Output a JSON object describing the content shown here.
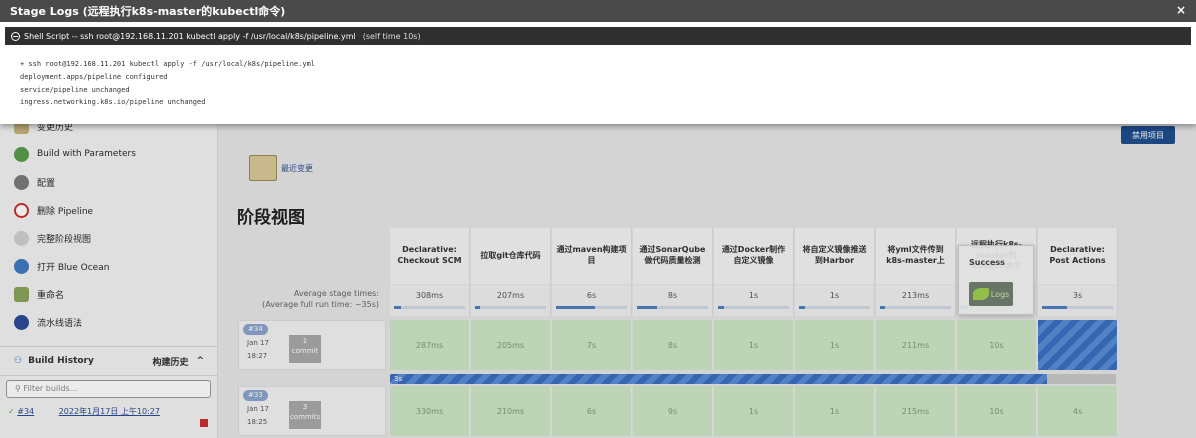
{
  "modal": {
    "title": "Stage Logs (远程执行k8s-master的kubectl命令)",
    "close_label": "×",
    "step": {
      "name": "Shell Script -- ssh root@192.168.11.201 kubectl apply -f /usr/local/k8s/pipeline.yml",
      "self_time": "(self time 10s)"
    },
    "log_lines": [
      "+ ssh root@192.168.11.201 kubectl apply -f /usr/local/k8s/pipeline.yml",
      "deployment.apps/pipeline configured",
      "service/pipeline unchanged",
      "ingress.networking.k8s.io/pipeline unchanged"
    ]
  },
  "sidebar": {
    "items": [
      {
        "label": "变更历史",
        "icon": "notepad-icon",
        "color": "#c6b27a"
      },
      {
        "label": "Build with Parameters",
        "icon": "build-icon",
        "color": "#5a9b4a"
      },
      {
        "label": "配置",
        "icon": "gear-icon",
        "color": "#7a7a7a"
      },
      {
        "label": "删除 Pipeline",
        "icon": "no-icon",
        "color": "#c93030"
      },
      {
        "label": "完整阶段视图",
        "icon": "search-icon",
        "color": "#8a8a8a"
      },
      {
        "label": "打开 Blue Ocean",
        "icon": "blue-ocean-icon",
        "color": "#3d7ac0"
      },
      {
        "label": "重命名",
        "icon": "rename-icon",
        "color": "#8ba35c"
      },
      {
        "label": "流水线语法",
        "icon": "help-icon",
        "color": "#2c4c95"
      }
    ],
    "build_history": {
      "label": "Build History",
      "label_cn": "构建历史",
      "toggle": "^"
    },
    "filter_placeholder": "Filter builds...",
    "builds": [
      {
        "number": "#34",
        "date": "2022年1月17日 上午10:27"
      }
    ]
  },
  "main": {
    "disable_button": "禁用项目",
    "recent_changes": "最近变更",
    "stage_view_title": "阶段视图",
    "avg_label": "Average stage times:",
    "avg_runtime": "(Average full run time: ~35s)",
    "stages": [
      {
        "name": "Declarative: Checkout SCM",
        "avg": "308ms",
        "fill": 0.1
      },
      {
        "name": "拉取git仓库代码",
        "avg": "207ms",
        "fill": 0.07
      },
      {
        "name": "通过maven构建项目",
        "avg": "6s",
        "fill": 0.55
      },
      {
        "name": "通过SonarQube做代码质量检测",
        "avg": "8s",
        "fill": 0.28
      },
      {
        "name": "通过Docker制作自定义镜像",
        "avg": "1s",
        "fill": 0.08
      },
      {
        "name": "将自定义镜像推送到Harbor",
        "avg": "1s",
        "fill": 0.08
      },
      {
        "name": "将yml文件传到k8s-master上",
        "avg": "213ms",
        "fill": 0.07
      },
      {
        "name": "远程执行k8s-master的kubectl命令",
        "avg": "",
        "fill": 0.1
      },
      {
        "name": "Declarative: Post Actions",
        "avg": "3s",
        "fill": 0.35
      }
    ],
    "runs": [
      {
        "badge": "#34",
        "date": "Jan 17",
        "time": "18:27",
        "commits": "1",
        "commit_label": "commit",
        "cells": [
          "287ms",
          "205ms",
          "7s",
          "8s",
          "1s",
          "1s",
          "211ms",
          "10s",
          ""
        ]
      },
      {
        "badge": "#33",
        "date": "Jan 17",
        "time": "18:25",
        "commits": "3",
        "commit_label": "commits",
        "cells": [
          "330ms",
          "210ms",
          "6s",
          "9s",
          "1s",
          "1s",
          "215ms",
          "10s",
          "4s"
        ]
      }
    ],
    "progress_label": "3s",
    "tooltip": {
      "status": "Success",
      "logs_label": "Logs"
    }
  }
}
